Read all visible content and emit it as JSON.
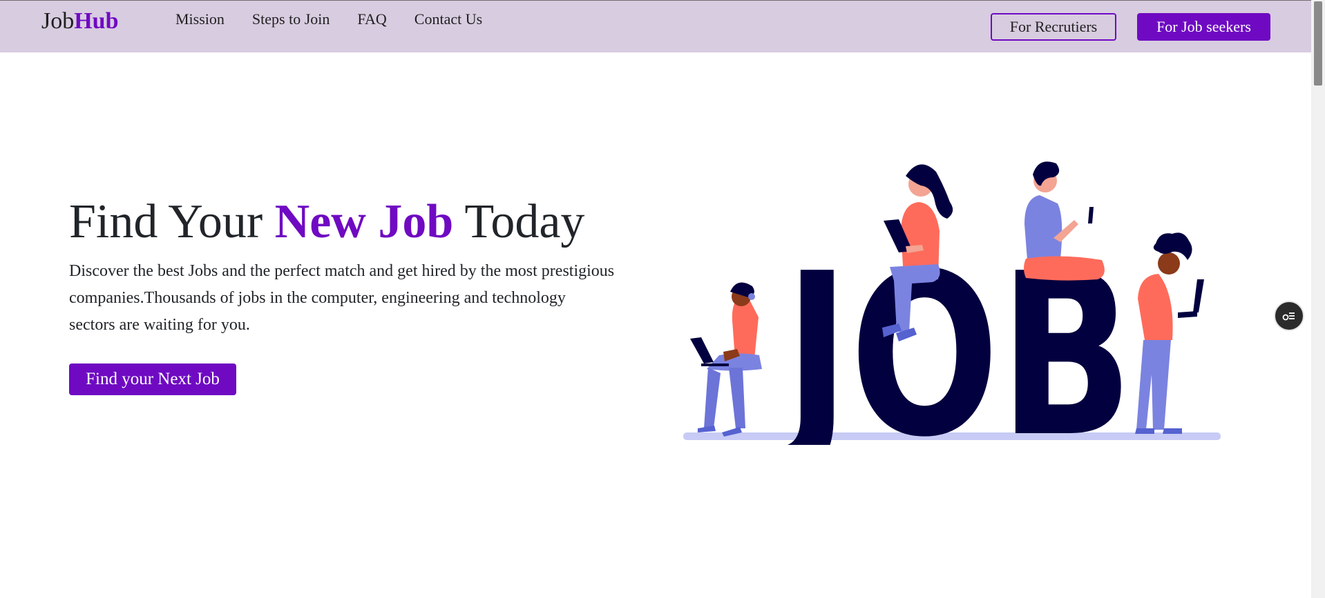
{
  "brand": {
    "part1": "Job",
    "part2": "Hub"
  },
  "nav": {
    "links": [
      "Mission",
      "Steps to Join",
      "FAQ",
      "Contact Us"
    ],
    "recruiters_label": "For Recrutiers",
    "seekers_label": "For Job seekers"
  },
  "hero": {
    "title_before": "Find Your ",
    "title_accent": "New Job",
    "title_after": " Today",
    "description": "Discover the best Jobs and the perfect match and get hired by the most prestigious companies.Thousands of jobs in the computer, engineering and technology sectors are waiting for you.",
    "cta_label": "Find your Next Job"
  },
  "illustration": {
    "word": "JOB"
  },
  "colors": {
    "accent": "#6f0ac2",
    "navbar_bg": "#d8cce0",
    "illustration_navy": "#03003f",
    "illustration_coral": "#ff6b5b",
    "illustration_periwinkle": "#7b83e0"
  }
}
